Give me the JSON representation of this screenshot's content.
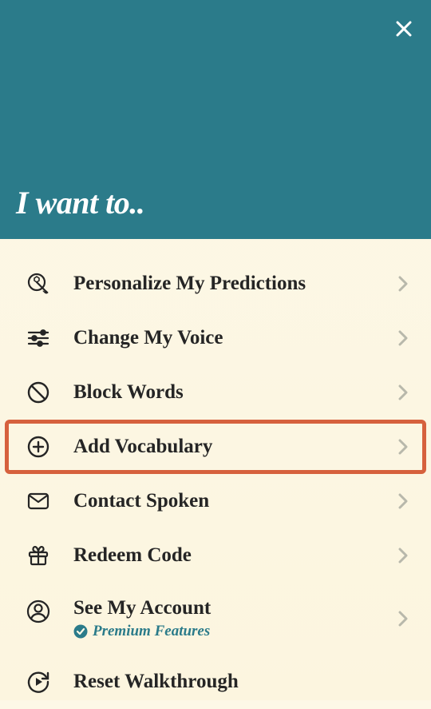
{
  "header": {
    "title": "I want to.."
  },
  "menu": {
    "items": [
      {
        "id": "personalize",
        "label": "Personalize My Predictions",
        "icon": "magnify-wrench-icon"
      },
      {
        "id": "voice",
        "label": "Change My Voice",
        "icon": "sliders-icon"
      },
      {
        "id": "block",
        "label": "Block Words",
        "icon": "ban-icon"
      },
      {
        "id": "vocab",
        "label": "Add Vocabulary",
        "icon": "plus-circle-icon",
        "highlighted": true
      },
      {
        "id": "contact",
        "label": "Contact Spoken",
        "icon": "mail-icon"
      },
      {
        "id": "redeem",
        "label": "Redeem Code",
        "icon": "gift-icon"
      },
      {
        "id": "account",
        "label": "See My Account",
        "icon": "user-circle-icon",
        "subLabel": "Premium Features"
      },
      {
        "id": "reset",
        "label": "Reset Walkthrough",
        "icon": "play-reload-icon"
      }
    ]
  }
}
